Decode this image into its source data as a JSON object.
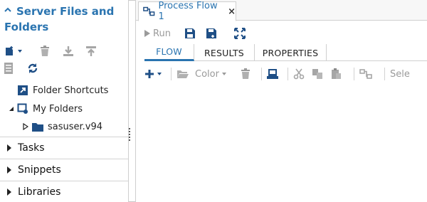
{
  "left_pane": {
    "title_line1": "Server Files and",
    "title_line2": "Folders",
    "toolbar": {
      "icons": [
        "new-icon",
        "delete-icon",
        "download-icon",
        "upload-icon",
        "properties-icon",
        "refresh-icon"
      ]
    },
    "tree": [
      {
        "label": "Folder Shortcuts",
        "icon": "folder-shortcut-icon"
      },
      {
        "label": "My Folders",
        "icon": "my-folders-icon",
        "expanded": true
      },
      {
        "label": "sasuser.v94",
        "icon": "folder-icon",
        "expanded": false
      }
    ],
    "sections": [
      {
        "label": "Tasks"
      },
      {
        "label": "Snippets"
      },
      {
        "label": "Libraries"
      }
    ]
  },
  "editor": {
    "tab": {
      "label": "Process Flow 1",
      "close": "×"
    },
    "toolbar": {
      "run_label": "Run"
    },
    "sub_tabs": [
      {
        "label": "FLOW",
        "active": true
      },
      {
        "label": "RESULTS",
        "active": false
      },
      {
        "label": "PROPERTIES",
        "active": false
      }
    ],
    "flow_toolbar": {
      "color_label": "Color",
      "select_label": "Sele"
    }
  },
  "colors": {
    "accent": "#2a74b0",
    "icon_dark": "#1f4f86",
    "disabled": "#9a9a9a"
  }
}
